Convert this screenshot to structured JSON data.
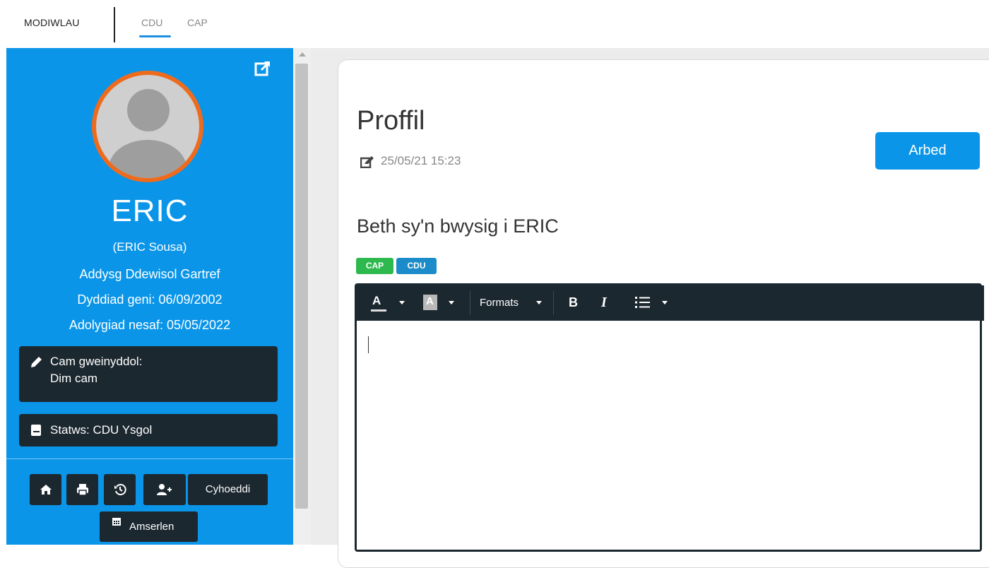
{
  "topnav": {
    "modules_label": "MODIWLAU",
    "tabs": [
      {
        "label": "CDU",
        "active": true
      },
      {
        "label": "CAP",
        "active": false
      }
    ]
  },
  "sidebar": {
    "name": "ERIC",
    "full_name": "(ERIC Sousa)",
    "line1": "Addysg Ddewisol Gartref",
    "line2": "Dyddiad geni: 06/09/2002",
    "line3": "Adolygiad nesaf: 05/05/2022",
    "role_card": {
      "line1": "Cam gweinyddol:",
      "line2": "Dim cam"
    },
    "status_card": "Statws: CDU Ysgol",
    "buttons": {
      "publish": "Cyhoeddi",
      "schedule": "Amserlen"
    }
  },
  "main": {
    "title": "Proffil",
    "edited": "25/05/21 15:23",
    "save_label": "Arbed",
    "section_title": "Beth sy'n bwysig i ERIC",
    "tags": [
      "CAP",
      "CDU"
    ],
    "editor": {
      "formats_label": "Formats",
      "font_color_glyph": "A",
      "bg_color_glyph": "A",
      "bold_glyph": "B",
      "italic_glyph": "I"
    }
  },
  "colors": {
    "accent_blue": "#0a95e8",
    "dark": "#1c2830",
    "avatar_ring": "#ee6b1e",
    "tag_cap": "#2eb94f",
    "tag_cdu": "#1b8cc9"
  },
  "icons": [
    "external-edit-icon",
    "pencil-icon",
    "book-icon",
    "home-icon",
    "print-icon",
    "history-icon",
    "add-user-icon",
    "calendar-icon",
    "edit-note-icon",
    "list-icon"
  ]
}
